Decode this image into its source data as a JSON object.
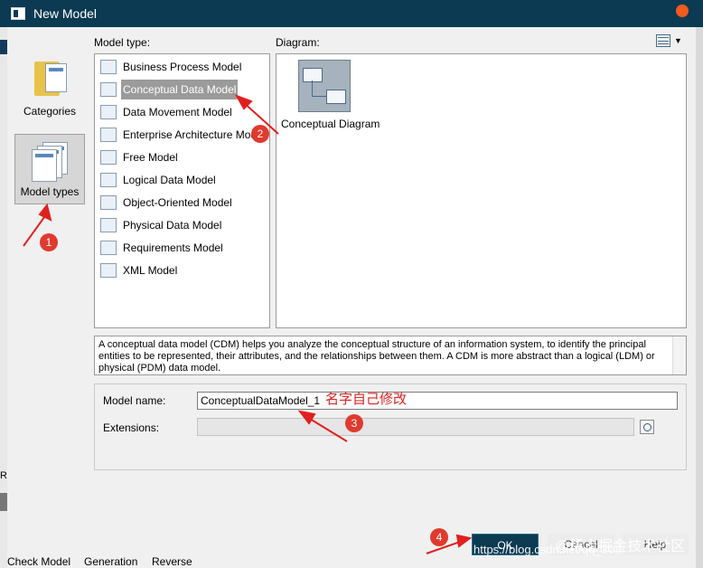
{
  "window": {
    "title": "New Model"
  },
  "left_panel": {
    "categories_label": "Categories",
    "model_types_label": "Model types"
  },
  "model_type_label": "Model type:",
  "diagram_label": "Diagram:",
  "model_types": [
    {
      "label": "Business Process Model",
      "icon": "process-model-icon"
    },
    {
      "label": "Conceptual Data Model",
      "icon": "conceptual-model-icon",
      "selected": true
    },
    {
      "label": "Data Movement Model",
      "icon": "data-movement-icon"
    },
    {
      "label": "Enterprise Architecture Model",
      "icon": "enterprise-architecture-icon"
    },
    {
      "label": "Free Model",
      "icon": "free-model-icon"
    },
    {
      "label": "Logical Data Model",
      "icon": "logical-model-icon"
    },
    {
      "label": "Object-Oriented Model",
      "icon": "object-oriented-icon"
    },
    {
      "label": "Physical Data Model",
      "icon": "physical-model-icon"
    },
    {
      "label": "Requirements Model",
      "icon": "requirements-icon"
    },
    {
      "label": "XML Model",
      "icon": "xml-model-icon"
    }
  ],
  "diagram": {
    "label": "Conceptual Diagram"
  },
  "description": "A conceptual data model (CDM) helps you analyze the conceptual structure of an information system, to identify the principal entities to be represented, their attributes, and the relationships between them. A CDM is more abstract than a logical (LDM) or physical (PDM) data model.",
  "form": {
    "model_name_label": "Model name:",
    "model_name_value": "ConceptualDataModel_1",
    "extensions_label": "Extensions:",
    "extensions_value": ""
  },
  "annotation": {
    "text": "名字自己修改"
  },
  "badges": [
    "1",
    "2",
    "3",
    "4"
  ],
  "buttons": {
    "ok": "OK",
    "cancel": "Cancel",
    "help": "Help"
  },
  "background_tabs": {
    "check": "Check Model",
    "generation": "Generation",
    "reverse": "Reverse",
    "edge": "Re"
  },
  "watermark": {
    "url": "https://blog.csdn.net/qq_20...",
    "brand": "@稀土掘金技术社区"
  },
  "colors": {
    "titlebar": "#0b3a52",
    "ok_button": "#0c3a51",
    "annotation": "#e02020"
  }
}
